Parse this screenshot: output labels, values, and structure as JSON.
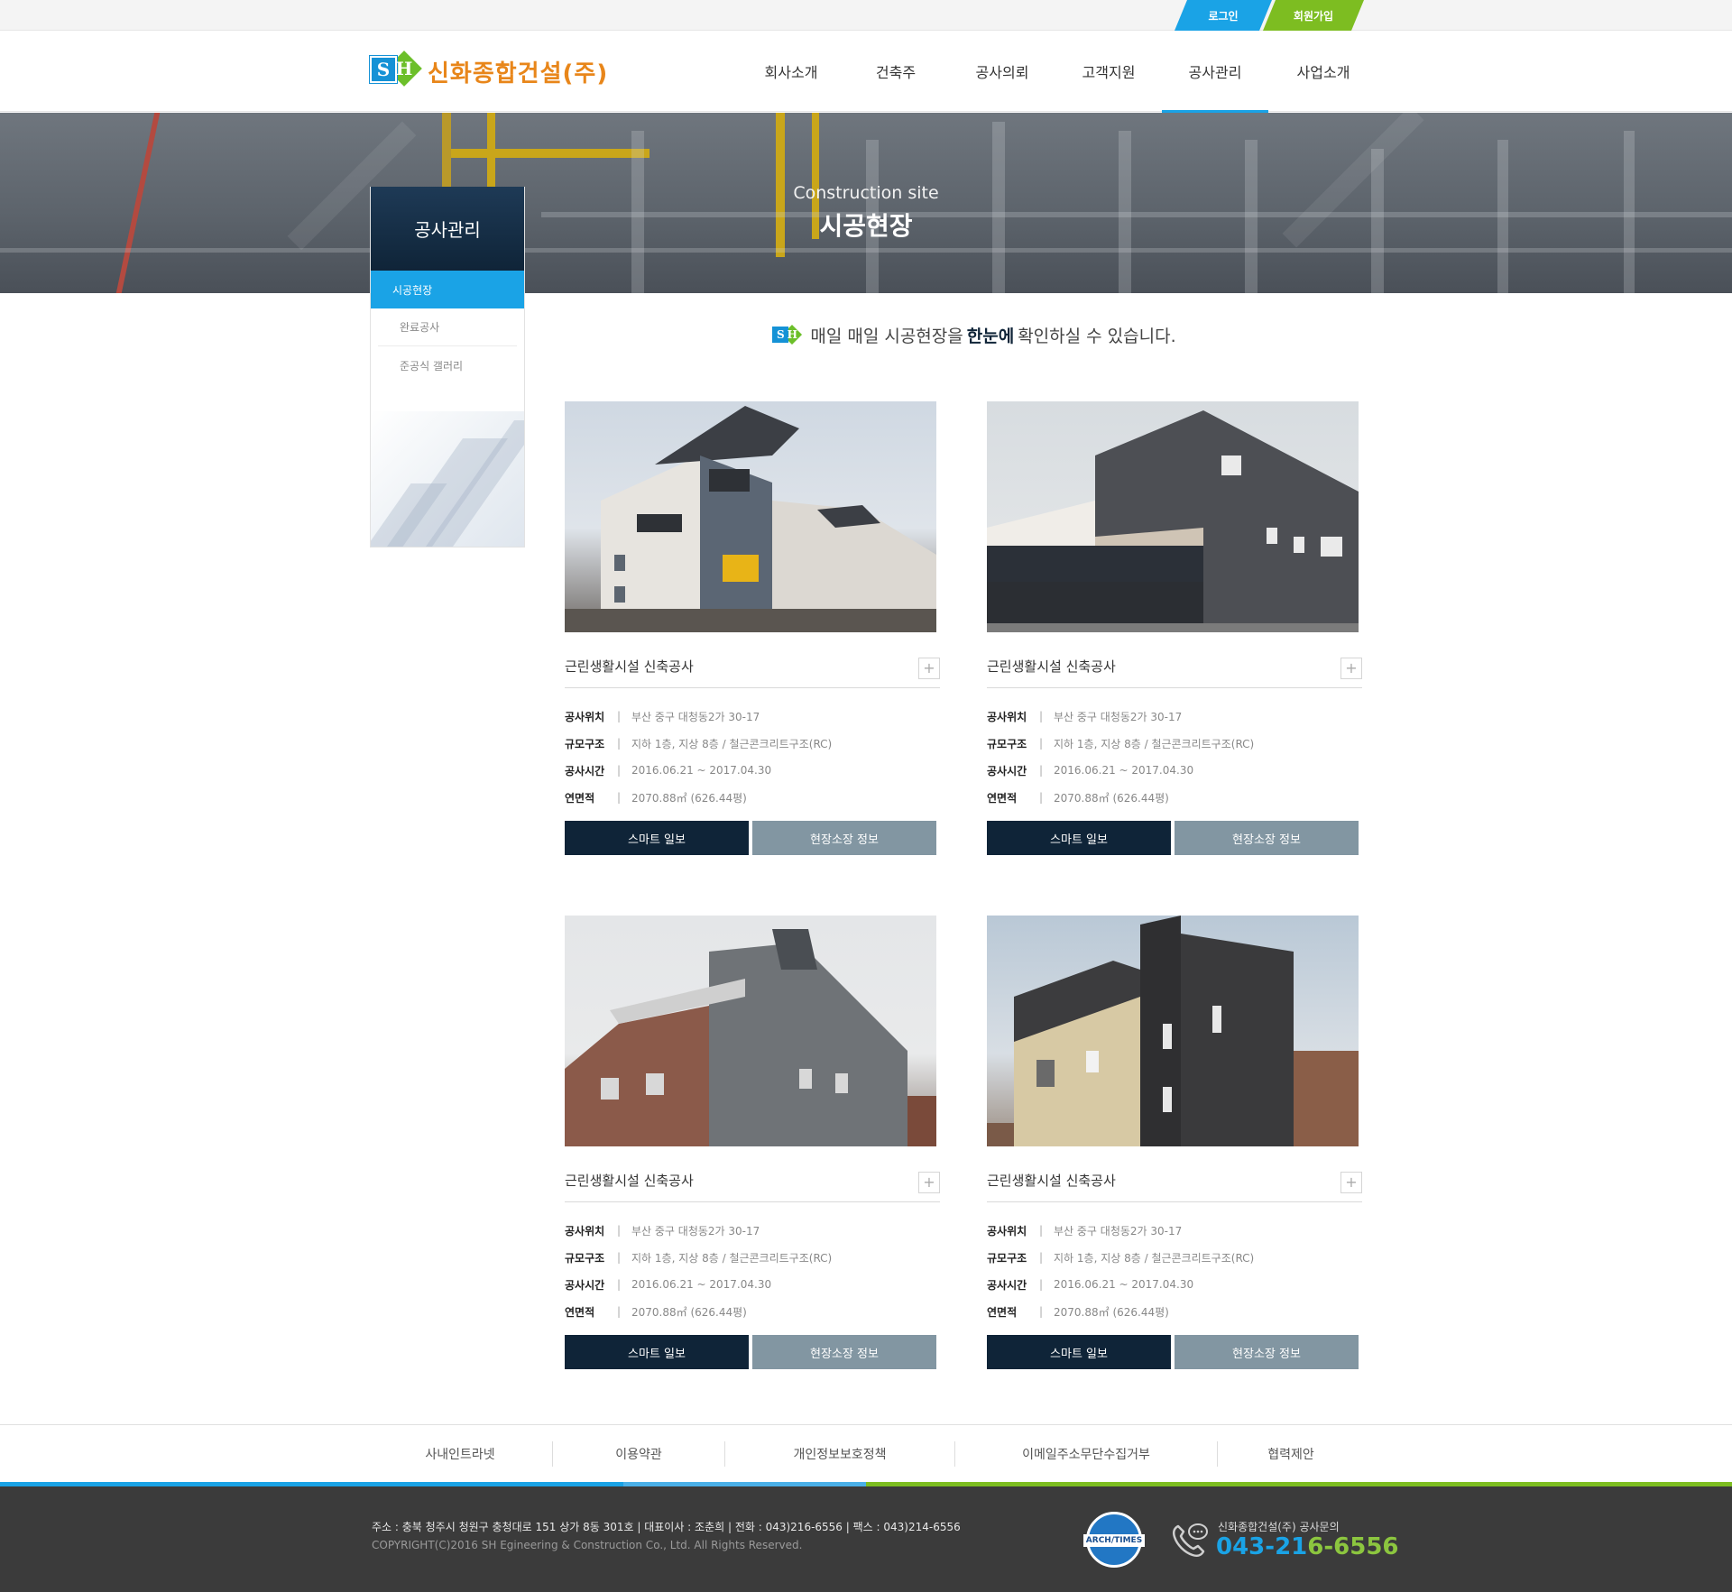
{
  "topbar": {
    "login": "로그인",
    "join": "회원가입"
  },
  "header": {
    "logo_mark": "SH",
    "logo_text": "신화종합건설(주)",
    "nav": [
      {
        "label": "회사소개"
      },
      {
        "label": "건축주"
      },
      {
        "label": "공사의뢰"
      },
      {
        "label": "고객지원"
      },
      {
        "label": "공사관리"
      },
      {
        "label": "사업소개"
      }
    ],
    "active_nav": "공사관리"
  },
  "banner": {
    "subtitle": "Construction site",
    "title": "시공현장"
  },
  "lnb": {
    "title": "공사관리",
    "items": [
      {
        "label": "시공현장"
      },
      {
        "label": "완료공사"
      },
      {
        "label": "준공식 갤러리"
      }
    ],
    "active": "시공현장"
  },
  "intro": {
    "prefix": "매일 매일 시공현장을",
    "highlight": "한눈에",
    "suffix": "확인하실 수 있습니다."
  },
  "cards": [
    {
      "title": "근린생활시설 신축공사",
      "rows": [
        {
          "k": "공사위치",
          "v": "부산 중구 대청동2가 30-17"
        },
        {
          "k": "규모구조",
          "v": "지하 1층, 지상 8층 / 철근콘크리트구조(RC)"
        },
        {
          "k": "공사시간",
          "v": "2016.06.21 ~ 2017.04.30"
        },
        {
          "k": "연면적",
          "v": "2070.88㎡ (626.44평)"
        }
      ],
      "btn1": "스마트 일보",
      "btn2": "현장소장 정보"
    },
    {
      "title": "근린생활시설 신축공사",
      "rows": [
        {
          "k": "공사위치",
          "v": "부산 중구 대청동2가 30-17"
        },
        {
          "k": "규모구조",
          "v": "지하 1층, 지상 8층 / 철근콘크리트구조(RC)"
        },
        {
          "k": "공사시간",
          "v": "2016.06.21 ~ 2017.04.30"
        },
        {
          "k": "연면적",
          "v": "2070.88㎡ (626.44평)"
        }
      ],
      "btn1": "스마트 일보",
      "btn2": "현장소장 정보"
    },
    {
      "title": "근린생활시설 신축공사",
      "rows": [
        {
          "k": "공사위치",
          "v": "부산 중구 대청동2가 30-17"
        },
        {
          "k": "규모구조",
          "v": "지하 1층, 지상 8층 / 철근콘크리트구조(RC)"
        },
        {
          "k": "공사시간",
          "v": "2016.06.21 ~ 2017.04.30"
        },
        {
          "k": "연면적",
          "v": "2070.88㎡ (626.44평)"
        }
      ],
      "btn1": "스마트 일보",
      "btn2": "현장소장 정보"
    },
    {
      "title": "근린생활시설 신축공사",
      "rows": [
        {
          "k": "공사위치",
          "v": "부산 중구 대청동2가 30-17"
        },
        {
          "k": "규모구조",
          "v": "지하 1층, 지상 8층 / 철근콘크리트구조(RC)"
        },
        {
          "k": "공사시간",
          "v": "2016.06.21 ~ 2017.04.30"
        },
        {
          "k": "연면적",
          "v": "2070.88㎡ (626.44평)"
        }
      ],
      "btn1": "스마트 일보",
      "btn2": "현장소장 정보"
    }
  ],
  "footer_nav": [
    {
      "label": "사내인트라넷"
    },
    {
      "label": "이용약관"
    },
    {
      "label": "개인정보보호정책"
    },
    {
      "label": "이메일주소무단수집거부"
    },
    {
      "label": "협력제안"
    }
  ],
  "footer": {
    "address": "주소 : 충북 청주시 청원구 충청대로 151 상가 8동 301호   |   대표이사 : 조춘희   |   전화 : 043)216-6556   |   팩스 : 043)214-6556",
    "copyright": "COPYRIGHT(C)2016  SH Egineering & Construction  Co., Ltd. All Rights Reserved.",
    "badge_text": "ARCH/TIMES",
    "phone_label": "신화종합건설(주) 공사문의",
    "phone_blue": "043-21",
    "phone_green": "6-6556"
  },
  "colors": {
    "accent_blue": "#1aa3e6",
    "accent_green": "#7dbd21",
    "navy": "#0f2438",
    "logo_orange": "#e8861a"
  }
}
